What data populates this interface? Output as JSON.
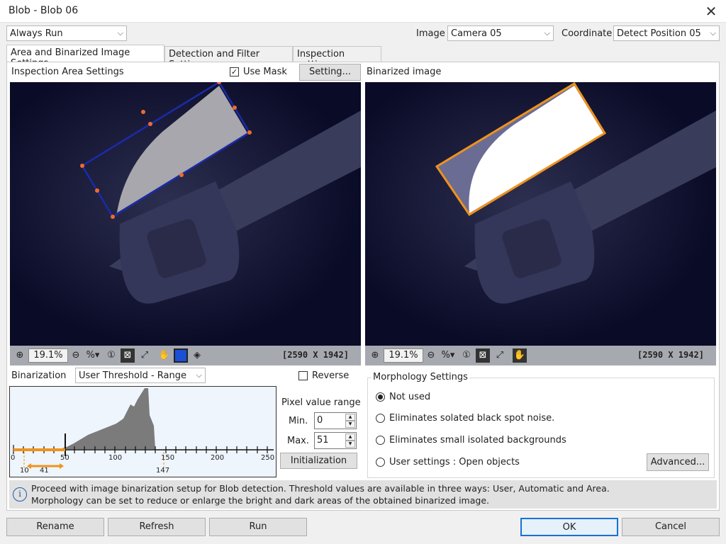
{
  "window": {
    "title": "Blob - Blob 06"
  },
  "top": {
    "run_mode": "Always Run",
    "image_label": "Image",
    "image_value": "Camera 05",
    "coordinate_label": "Coordinate",
    "coordinate_value": "Detect Position 05"
  },
  "tabs": [
    {
      "label": "Area and Binarized Image Settings"
    },
    {
      "label": "Detection and Filter Settings"
    },
    {
      "label": "Inspection settings"
    }
  ],
  "left_panel": {
    "title": "Inspection Area Settings",
    "use_mask_label": "Use Mask",
    "use_mask_checked": true,
    "setting_button": "Setting...",
    "zoom": "19.1%",
    "resolution": "[2590 X 1942]"
  },
  "right_panel": {
    "title": "Binarized image",
    "zoom": "19.1%",
    "resolution": "[2590 X 1942]"
  },
  "binarization": {
    "label": "Binarization",
    "mode": "User Threshold - Range",
    "reverse_label": "Reverse",
    "reverse_checked": false,
    "histogram_ticks": [
      "0",
      "50",
      "100",
      "150",
      "200",
      "250"
    ],
    "markers": [
      "10",
      "41",
      "147"
    ],
    "pixel_range_label": "Pixel value range",
    "min_label": "Min.",
    "min_value": "0",
    "max_label": "Max.",
    "max_value": "51",
    "init_button": "Initialization"
  },
  "morphology": {
    "title": "Morphology Settings",
    "options": [
      {
        "label": "Not used",
        "selected": true
      },
      {
        "label": "Eliminates solated black spot noise.",
        "selected": false
      },
      {
        "label": "Eliminates small isolated backgrounds",
        "selected": false
      },
      {
        "label": "User settings : Open objects",
        "selected": false
      }
    ],
    "advanced_button": "Advanced..."
  },
  "info": {
    "line1": "Proceed with image binarization setup for Blob detection. Threshold values are available in three ways: User, Automatic and Area.",
    "line2": "Morphology can be set to reduce or enlarge the bright and dark areas of the obtained binarized image."
  },
  "footer": {
    "rename": "Rename",
    "refresh": "Refresh",
    "run": "Run",
    "ok": "OK",
    "cancel": "Cancel"
  },
  "colors": {
    "accent_blue": "#1a4fd6",
    "roi_orange": "#f0921c",
    "image_bg": "#090a26",
    "histogram_bg": "#eef5fc"
  }
}
